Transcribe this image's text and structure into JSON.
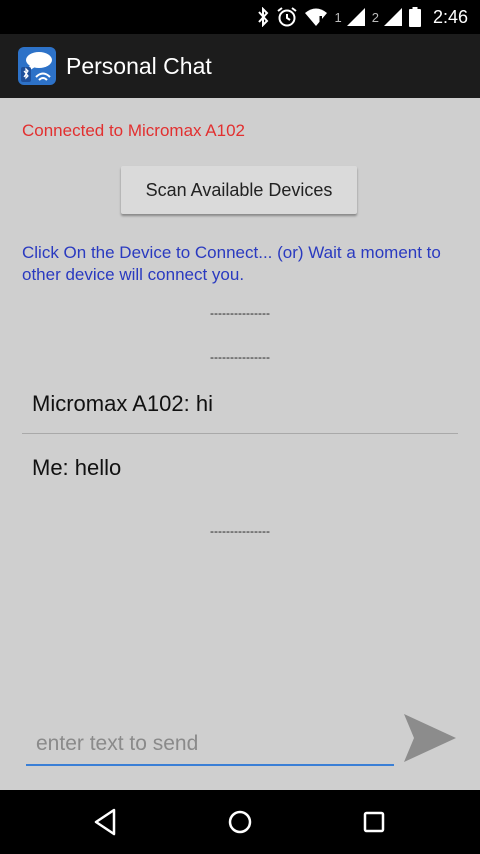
{
  "status_bar": {
    "time": "2:46",
    "sim1_label": "1",
    "sim2_label": "2",
    "icons": [
      "bluetooth-icon",
      "alarm-icon",
      "wifi-icon",
      "signal-icon",
      "battery-icon"
    ]
  },
  "app": {
    "title": "Personal Chat",
    "icon": "chat-bluetooth-icon"
  },
  "connection_status": "Connected to Micromax A102",
  "scan_button_label": "Scan Available Devices",
  "instructions": "Click On the Device to Connect... (or) Wait a moment to other device will connect you.",
  "dividers": [
    "---------------",
    "---------------",
    "---------------"
  ],
  "messages": [
    {
      "text": "Micromax A102:  hi"
    },
    {
      "text": "Me:  hello"
    }
  ],
  "input": {
    "value": "",
    "placeholder": "enter text to send"
  },
  "send_icon": "send-icon",
  "nav": [
    "back-icon",
    "home-icon",
    "recents-icon"
  ],
  "colors": {
    "status_text": "#e23030",
    "instructions_text": "#2a3ac0",
    "input_accent": "#3a7fd6",
    "background": "#cfcfcf"
  }
}
